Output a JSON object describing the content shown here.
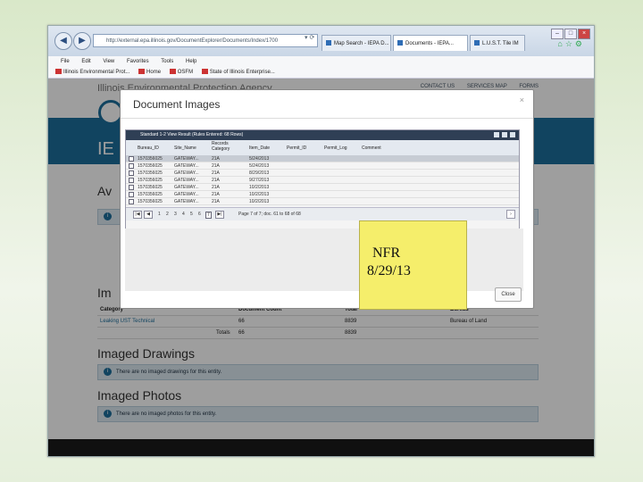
{
  "browser": {
    "address": "http://external.epa.illinois.gov/DocumentExplorer/Documents/Index/1700",
    "tabs": [
      "Map Search - IEPA D...",
      "Documents - IEPA...",
      "L.U.S.T. Tile IM"
    ],
    "menu": [
      "File",
      "Edit",
      "View",
      "Favorites",
      "Tools",
      "Help"
    ],
    "favorites": [
      "Illinois Environmental Prot...",
      "Home",
      "OSFM",
      "State of Illinois Enterprise..."
    ]
  },
  "page": {
    "agency": "Illinois Environmental Protection Agency",
    "top_links": [
      "CONTACT US",
      "SERVICES MAP",
      "FORMS"
    ],
    "banner_title": "IE",
    "section_available": "Av",
    "section_imaged": "Im",
    "table": {
      "headers": [
        "Category",
        "Document Count",
        "Total",
        "Bureau"
      ],
      "rows": [
        [
          "Leaking UST Technical",
          "66",
          "8839",
          "Bureau of Land"
        ]
      ],
      "totals": [
        "Totals",
        "66",
        "8839"
      ]
    },
    "imaged_drawings": "Imaged Drawings",
    "drawings_msg": "There are no imaged drawings for this entity.",
    "imaged_photos": "Imaged Photos",
    "photos_msg": "There are no imaged photos for this entity."
  },
  "modal": {
    "title": "Document Images",
    "close_x": "×",
    "grid_title": "Standard 1-2 View Result (Rules Entered: 68 Rows)",
    "columns": [
      "Bureau_ID",
      "Site_Name",
      "Records Category",
      "Item_Date",
      "Permit_ID",
      "Permit_Log",
      "Comment"
    ],
    "rows": [
      [
        "1570356025",
        "GATEWAY...",
        "21A",
        "5/24/2013"
      ],
      [
        "1570356025",
        "GATEWAY...",
        "21A",
        "5/24/2013"
      ],
      [
        "1570356025",
        "GATEWAY...",
        "21A",
        "8/29/2013"
      ],
      [
        "1570356025",
        "GATEWAY...",
        "21A",
        "9/27/2013"
      ],
      [
        "1570356025",
        "GATEWAY...",
        "21A",
        "10/2/2013"
      ],
      [
        "1570356025",
        "GATEWAY...",
        "21A",
        "10/2/2013"
      ],
      [
        "1570356025",
        "GATEWAY...",
        "21A",
        "10/2/2013"
      ]
    ],
    "pager_pages": [
      "1",
      "2",
      "3",
      "4",
      "5",
      "6",
      "7"
    ],
    "pager_current": "7",
    "pager_status": "Page 7 of 7; doc. 61 to 68 of 68",
    "close_label": "Close"
  },
  "note": {
    "line1": "NFR",
    "line2": "8/29/13"
  }
}
